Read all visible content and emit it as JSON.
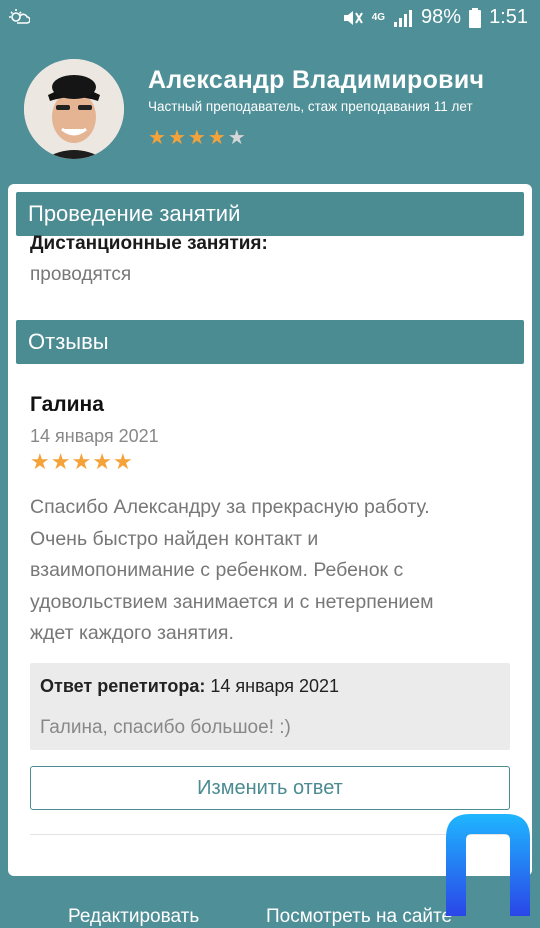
{
  "status_bar": {
    "battery": "98%",
    "time": "1:51",
    "network": "4G"
  },
  "profile": {
    "name": "Александр Владимирович",
    "subtitle": "Частный преподаватель, стаж преподавания 11 лет",
    "rating_stars": 4,
    "rating_max": 5
  },
  "sections": {
    "classes": {
      "header": "Проведение занятий",
      "label": "Дистанционные занятия:",
      "value": "проводятся"
    },
    "reviews": {
      "header": "Отзывы"
    }
  },
  "review": {
    "author": "Галина",
    "date": "14 января 2021",
    "stars": 5,
    "text": "Спасибо Александру за прекрасную работу. Очень быстро найден контакт и взаимопонимание с ребенком. Ребенок с удовольствием занимается и с нетерпением ждет каждого занятия.",
    "reply": {
      "label": "Ответ репетитора:",
      "date": "14 января 2021",
      "text": "Галина, спасибо большое! :)"
    },
    "edit_button": "Изменить ответ"
  },
  "bottom_links": {
    "edit": "Редактировать",
    "view_site": "Посмотреть на сайте"
  },
  "colors": {
    "background": "#4f8f97",
    "section_header": "#4b8b92",
    "star": "#f4a33a"
  }
}
